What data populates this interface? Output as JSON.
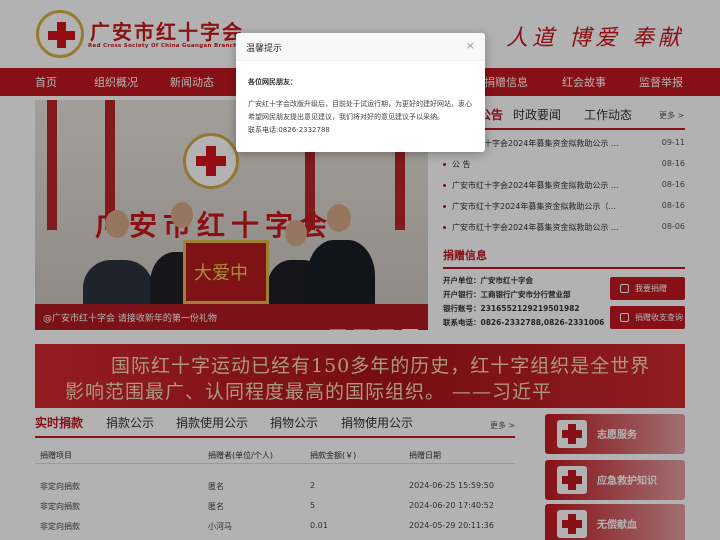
{
  "header": {
    "logo_title": "广安市红十字会",
    "logo_subtitle": "Red Cross Society Of China Guangan Branch",
    "slogan": "人道 博爱 奉献"
  },
  "nav": {
    "items": [
      "首页",
      "组织概况",
      "新闻动态",
      "捐赠信息",
      "红会故事",
      "监督举报"
    ]
  },
  "slider": {
    "wall_text": "广安市红十字会",
    "banner_text": "大爱中",
    "caption": "@广安市红十字会 请接收新年的第一份礼物"
  },
  "news": {
    "tabs": [
      "公告",
      "时政要闻",
      "工作动态"
    ],
    "more": "更多 >",
    "items": [
      {
        "title": "广安市红十字会2024年募集资金拟救助公示 ...",
        "date": "09-11"
      },
      {
        "title": "公 告",
        "date": "08-16"
      },
      {
        "title": "广安市红十字会2024年募集资金拟救助公示 ...",
        "date": "08-16"
      },
      {
        "title": "广安市红十字2024年募集资金拟救助公示（...",
        "date": "08-16"
      },
      {
        "title": "广安市红十字会2024年募集资金拟救助公示 ...",
        "date": "08-06"
      }
    ]
  },
  "donation": {
    "title": "捐赠信息",
    "lines": [
      "开户单位：广安市红十字会",
      "开户银行：工商银行广安市分行营业部",
      "银行账号：2316552129219501982",
      "联系电话：0826-2332788,0826-2331006"
    ],
    "donate_button": "我要捐赠",
    "query_button": "捐赠收支查询"
  },
  "quote": {
    "line1": "国际红十字运动已经有150多年的历史，红十字组织是全世界",
    "line2": "影响范围最广、认同程度最高的国际组织。 ——习近平"
  },
  "table": {
    "tabs": [
      "实时捐款",
      "捐款公示",
      "捐款使用公示",
      "捐物公示",
      "捐物使用公示"
    ],
    "more": "更多 >",
    "headers": [
      "捐赠项目",
      "捐赠者(单位/个人)",
      "捐款金额(￥)",
      "捐赠日期"
    ],
    "rows": [
      [
        "非定向捐款",
        "匿名",
        "2",
        "2024-06-25 15:59:50"
      ],
      [
        "非定向捐款",
        "匿名",
        "5",
        "2024-06-20 17:40:52"
      ],
      [
        "非定向捐款",
        "小河马",
        "0.01",
        "2024-05-29 20:11:36"
      ]
    ]
  },
  "side_buttons": [
    "志愿服务",
    "应急救护知识",
    "无偿献血"
  ],
  "modal": {
    "title": "温馨提示",
    "close": "×",
    "greeting": "各位网民朋友：",
    "body": "广安红十字会改版升级后，目前处于试运行期，为更好的建好网站，衷心希望网民朋友提出意见建议，我们将对好的意见建议予以采纳。",
    "contact": "联系电话:0826-2332788"
  }
}
